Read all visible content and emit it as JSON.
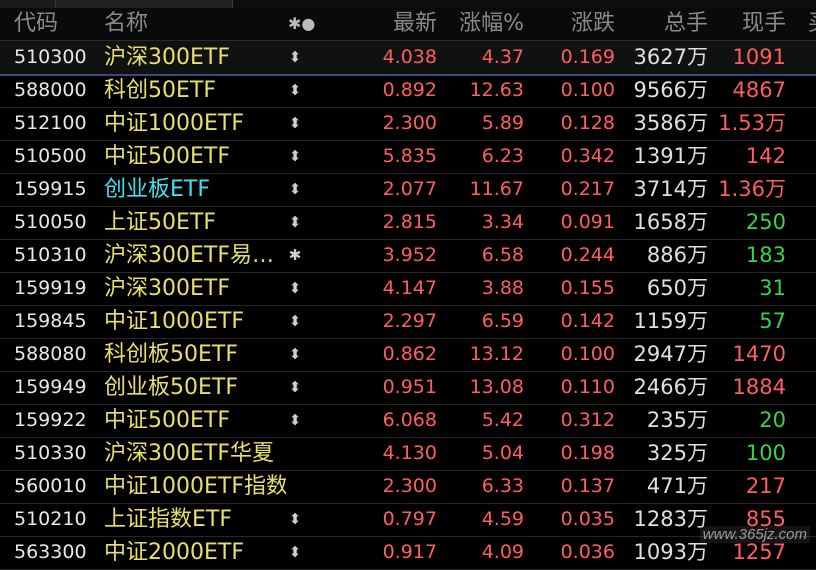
{
  "headers": {
    "code": "代码",
    "name": "名称",
    "sort_icon": "✱●",
    "price": "最新",
    "pct": "涨幅%",
    "change": "涨跌",
    "volume": "总手",
    "current": "现手",
    "edge": "买"
  },
  "colors": {
    "background": "#000000",
    "up_red": "#ff5e5e",
    "down_green": "#3ad24a",
    "name_yellow": "#e8e06a",
    "name_cyan": "#3fe0f0",
    "header_gray": "#8a8a8a"
  },
  "rows": [
    {
      "code": "510300",
      "name": "沪深300ETF",
      "flag": "⬍",
      "price": "4.038",
      "pct": "4.37",
      "change": "0.169",
      "volume": "3627万",
      "current": "1091",
      "current_color": "red",
      "name_color": "yellow",
      "selected": true
    },
    {
      "code": "588000",
      "name": "科创50ETF",
      "flag": "⬍",
      "price": "0.892",
      "pct": "12.63",
      "change": "0.100",
      "volume": "9566万",
      "current": "4867",
      "current_color": "red",
      "name_color": "yellow"
    },
    {
      "code": "512100",
      "name": "中证1000ETF",
      "flag": "⬍",
      "price": "2.300",
      "pct": "5.89",
      "change": "0.128",
      "volume": "3586万",
      "current": "1.53万",
      "current_color": "red",
      "name_color": "yellow"
    },
    {
      "code": "510500",
      "name": "中证500ETF",
      "flag": "⬍",
      "price": "5.835",
      "pct": "6.23",
      "change": "0.342",
      "volume": "1391万",
      "current": "142",
      "current_color": "red",
      "name_color": "yellow"
    },
    {
      "code": "159915",
      "name": "创业板ETF",
      "flag": "⬍",
      "price": "2.077",
      "pct": "11.67",
      "change": "0.217",
      "volume": "3714万",
      "current": "1.36万",
      "current_color": "red",
      "name_color": "cyan"
    },
    {
      "code": "510050",
      "name": "上证50ETF",
      "flag": "⬍",
      "price": "2.815",
      "pct": "3.34",
      "change": "0.091",
      "volume": "1658万",
      "current": "250",
      "current_color": "green",
      "name_color": "yellow"
    },
    {
      "code": "510310",
      "name": "沪深300ETF易…",
      "flag": "✱",
      "price": "3.952",
      "pct": "6.58",
      "change": "0.244",
      "volume": "886万",
      "current": "183",
      "current_color": "green",
      "name_color": "yellow"
    },
    {
      "code": "159919",
      "name": "沪深300ETF",
      "flag": "⬍",
      "price": "4.147",
      "pct": "3.88",
      "change": "0.155",
      "volume": "650万",
      "current": "31",
      "current_color": "green",
      "name_color": "yellow"
    },
    {
      "code": "159845",
      "name": "中证1000ETF",
      "flag": "⬍",
      "price": "2.297",
      "pct": "6.59",
      "change": "0.142",
      "volume": "1159万",
      "current": "57",
      "current_color": "green",
      "name_color": "yellow"
    },
    {
      "code": "588080",
      "name": "科创板50ETF",
      "flag": "⬍",
      "price": "0.862",
      "pct": "13.12",
      "change": "0.100",
      "volume": "2947万",
      "current": "1470",
      "current_color": "red",
      "name_color": "yellow"
    },
    {
      "code": "159949",
      "name": "创业板50ETF",
      "flag": "⬍",
      "price": "0.951",
      "pct": "13.08",
      "change": "0.110",
      "volume": "2466万",
      "current": "1884",
      "current_color": "red",
      "name_color": "yellow"
    },
    {
      "code": "159922",
      "name": "中证500ETF",
      "flag": "⬍",
      "price": "6.068",
      "pct": "5.42",
      "change": "0.312",
      "volume": "235万",
      "current": "20",
      "current_color": "green",
      "name_color": "yellow"
    },
    {
      "code": "510330",
      "name": "沪深300ETF华夏",
      "flag": "",
      "price": "4.130",
      "pct": "5.04",
      "change": "0.198",
      "volume": "325万",
      "current": "100",
      "current_color": "green",
      "name_color": "yellow"
    },
    {
      "code": "560010",
      "name": "中证1000ETF指数",
      "flag": "",
      "price": "2.300",
      "pct": "6.33",
      "change": "0.137",
      "volume": "471万",
      "current": "217",
      "current_color": "red",
      "name_color": "yellow"
    },
    {
      "code": "510210",
      "name": "上证指数ETF",
      "flag": "⬍",
      "price": "0.797",
      "pct": "4.59",
      "change": "0.035",
      "volume": "1283万",
      "current": "855",
      "current_color": "red",
      "name_color": "yellow"
    },
    {
      "code": "563300",
      "name": "中证2000ETF",
      "flag": "⬍",
      "price": "0.917",
      "pct": "4.09",
      "change": "0.036",
      "volume": "1093万",
      "current": "1257",
      "current_color": "red",
      "name_color": "yellow"
    }
  ],
  "watermark": "www.365jz.com"
}
